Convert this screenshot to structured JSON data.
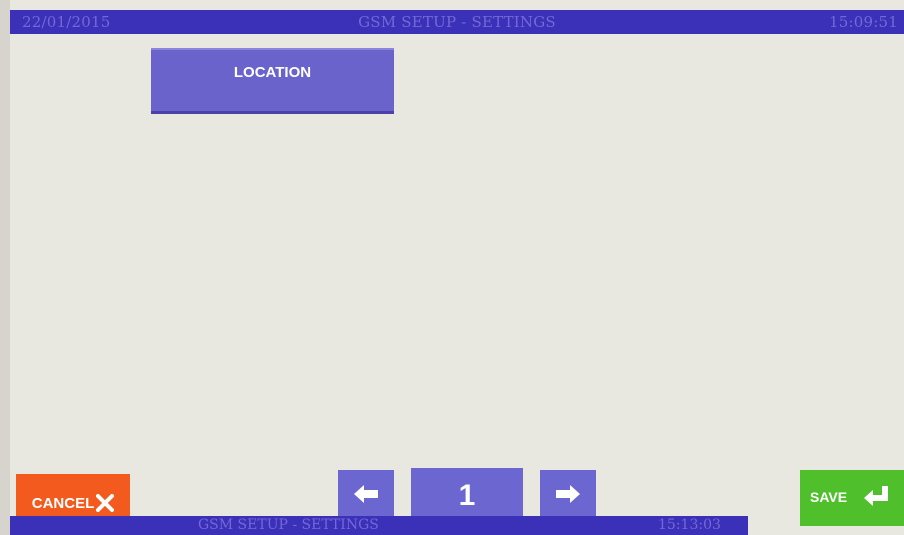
{
  "header": {
    "date": "22/01/2015",
    "title": "GSM SETUP - SETTINGS",
    "time": "15:09:51"
  },
  "main": {
    "location_button_label": "LOCATION"
  },
  "footer": {
    "cancel_label": "CANCEL",
    "page_number": "1",
    "save_label": "SAVE"
  },
  "overlay": {
    "title": "GSM SETUP - SETTINGS",
    "time": "15:13:03"
  },
  "icons": {
    "cancel": "close-icon",
    "previous": "arrow-left-icon",
    "next": "arrow-right-icon",
    "save": "enter-return-icon"
  },
  "colors": {
    "title_bar": "#3b30b8",
    "title_text": "#7468d6",
    "button_blue": "#6b66d0",
    "cancel_orange": "#f25a1e",
    "save_green": "#4fc02c",
    "background": "#e8e7e0"
  }
}
